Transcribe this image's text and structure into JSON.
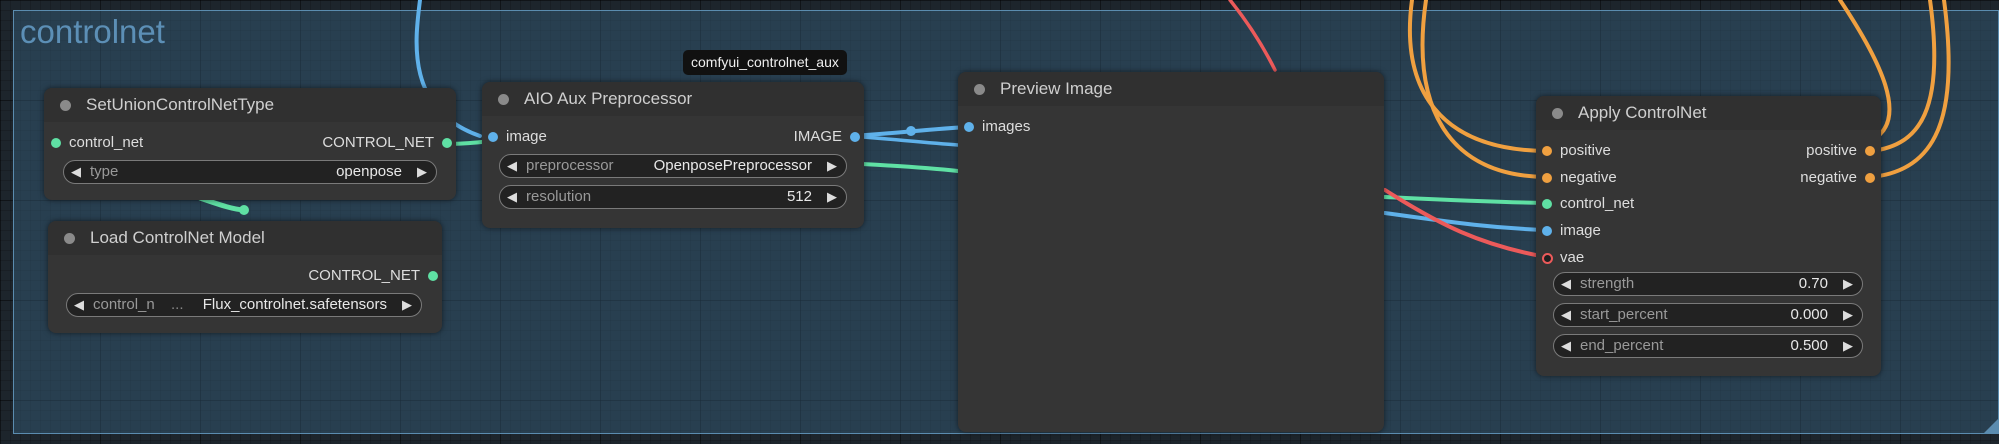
{
  "group": {
    "title": "controlnet"
  },
  "tooltip": "comfyui_controlnet_aux",
  "nodes": {
    "set_union": {
      "title": "SetUnionControlNetType",
      "input": "control_net",
      "output": "CONTROL_NET",
      "widget": {
        "label": "type",
        "value": "openpose"
      }
    },
    "load_controlnet": {
      "title": "Load ControlNet Model",
      "output": "CONTROL_NET",
      "widget": {
        "label": "control_n",
        "ellipsis": "...",
        "value": "Flux_controlnet.safetensors"
      }
    },
    "aio_aux": {
      "title": "AIO Aux Preprocessor",
      "input": "image",
      "output": "IMAGE",
      "widgets": [
        {
          "label": "preprocessor",
          "value": "OpenposePreprocessor"
        },
        {
          "label": "resolution",
          "value": "512"
        }
      ]
    },
    "preview": {
      "title": "Preview Image",
      "input": "images"
    },
    "apply_controlnet": {
      "title": "Apply ControlNet",
      "inputs": [
        "positive",
        "negative",
        "control_net",
        "image",
        "vae"
      ],
      "outputs": [
        "positive",
        "negative"
      ],
      "widgets": [
        {
          "label": "strength",
          "value": "0.70"
        },
        {
          "label": "start_percent",
          "value": "0.000"
        },
        {
          "label": "end_percent",
          "value": "0.500"
        }
      ]
    }
  },
  "icons": {
    "arrow_left": "◀",
    "arrow_right": "▶"
  },
  "colors": {
    "control_net_link": "#5fe0a4",
    "image_link": "#5fb1ea",
    "conditioning_link": "#f0a040",
    "vae_link": "#ec5a5a",
    "group_border": "#5b8caf"
  }
}
